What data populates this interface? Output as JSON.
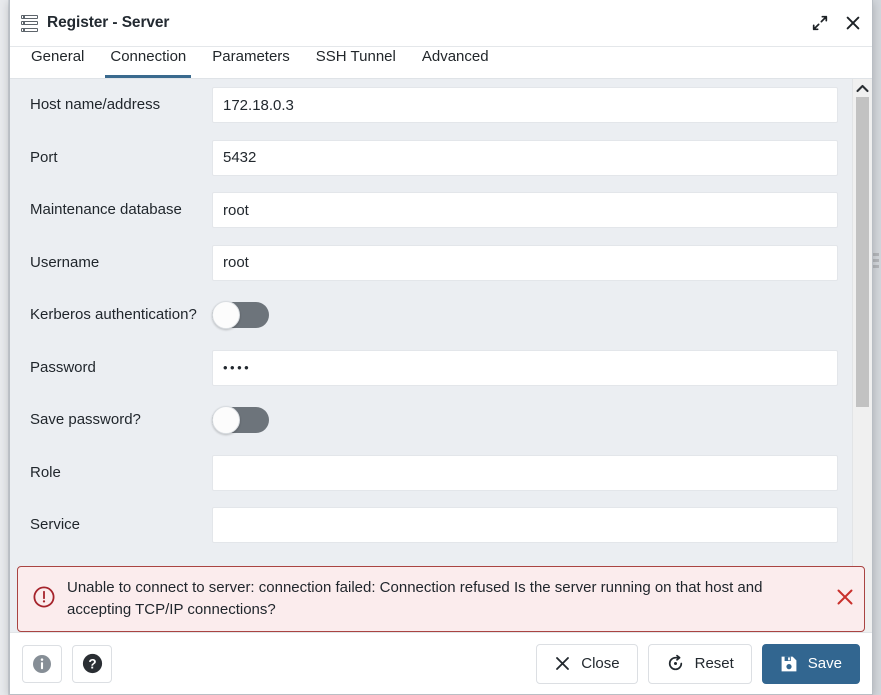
{
  "window": {
    "title": "Register - Server",
    "icon": "server-icon",
    "maximize_icon": "expand-icon",
    "close_icon": "close-icon"
  },
  "tabs": [
    {
      "label": "General",
      "active": false
    },
    {
      "label": "Connection",
      "active": true
    },
    {
      "label": "Parameters",
      "active": false
    },
    {
      "label": "SSH Tunnel",
      "active": false
    },
    {
      "label": "Advanced",
      "active": false
    }
  ],
  "form": {
    "fields": [
      {
        "label": "Host name/address",
        "type": "text",
        "value": "172.18.0.3",
        "name": "host-name-address"
      },
      {
        "label": "Port",
        "type": "text",
        "value": "5432",
        "name": "port"
      },
      {
        "label": "Maintenance database",
        "type": "text",
        "value": "root",
        "name": "maintenance-database"
      },
      {
        "label": "Username",
        "type": "text",
        "value": "root",
        "name": "username"
      },
      {
        "label": "Kerberos authentication?",
        "type": "toggle",
        "value": "off",
        "name": "kerberos-authentication"
      },
      {
        "label": "Password",
        "type": "password",
        "value": "••••",
        "name": "password"
      },
      {
        "label": "Save password?",
        "type": "toggle",
        "value": "off",
        "name": "save-password"
      },
      {
        "label": "Role",
        "type": "text",
        "value": "",
        "name": "role"
      },
      {
        "label": "Service",
        "type": "text",
        "value": "",
        "name": "service"
      }
    ]
  },
  "alert": {
    "icon": "error-circle-icon",
    "message": "Unable to connect to server: connection failed: Connection refused Is the server running on that host and accepting TCP/IP connections?",
    "close_icon": "close-icon",
    "border_color": "#a94442",
    "background_color": "#fbeced"
  },
  "footer": {
    "info_label": "i",
    "help_label": "?",
    "close_label": "Close",
    "reset_label": "Reset",
    "save_label": "Save",
    "save_color": "#326690"
  },
  "scrollbar": {
    "up_arrow_icon": "chevron-up-icon"
  }
}
